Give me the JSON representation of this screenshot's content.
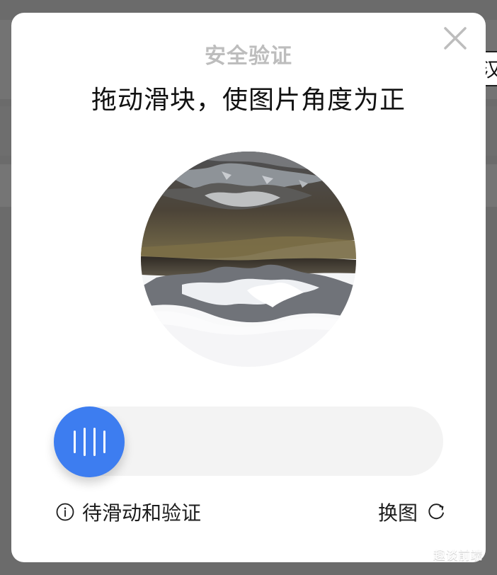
{
  "background": {
    "edge_text": "汉"
  },
  "modal": {
    "subtitle": "安全验证",
    "title": "拖动滑块，使图片角度为正",
    "status_text": "待滑动和验证",
    "refresh_text": "换图"
  },
  "icons": {
    "close": "close-icon",
    "slider": "grip-icon",
    "info": "info-icon",
    "refresh": "refresh-icon",
    "watermark": "wechat-icon"
  },
  "watermark": {
    "text": "趣谈前端"
  },
  "colors": {
    "accent": "#3d7df0",
    "track": "#f3f3f3",
    "subtitle": "#bdbdbd",
    "text": "#111111",
    "overlay": "#6b6b6b"
  }
}
